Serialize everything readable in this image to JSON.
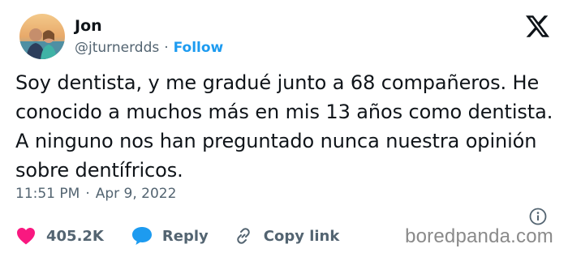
{
  "author": {
    "name": "Jon",
    "handle": "@jturnerdds",
    "separator": "·",
    "follow_label": "Follow"
  },
  "tweet": {
    "text": "Soy dentista, y me gradué junto a 68 compañeros. He\nconocido a muchos más en mis 13 años como dentista.\nA ninguno nos han preguntado nunca nuestra opinión\nsobre dentífricos.",
    "time": "11:51 PM",
    "separator": "·",
    "date": "Apr 9, 2022"
  },
  "actions": {
    "like_count": "405.2K",
    "reply_label": "Reply",
    "copy_link_label": "Copy link"
  },
  "icons": {
    "platform_logo": "x-logo-icon",
    "info": "info-icon",
    "like": "heart-icon",
    "reply": "speech-bubble-icon",
    "copy_link": "link-icon"
  },
  "colors": {
    "accent": "#1d9bf0",
    "like": "#f91880",
    "secondary_text": "#536471",
    "primary_text": "#0f1419"
  },
  "watermark": {
    "text": "boredpanda.com"
  }
}
